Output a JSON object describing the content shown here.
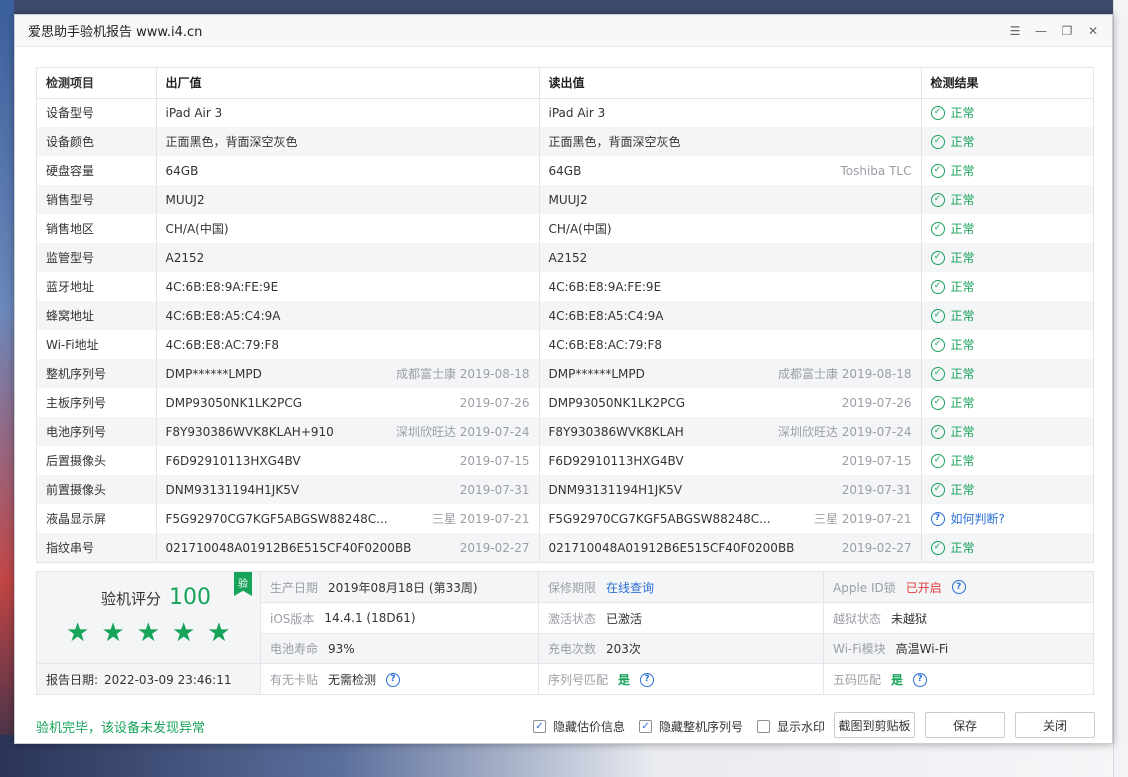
{
  "window": {
    "title": "爱思助手验机报告 www.i4.cn",
    "controls": [
      "menu-icon",
      "minimize-icon",
      "restore-icon",
      "close-icon"
    ]
  },
  "table": {
    "headers": [
      "检测项目",
      "出厂值",
      "读出值",
      "检测结果"
    ],
    "rows": [
      {
        "item": "设备型号",
        "factory": "iPad Air 3",
        "factory_note": "",
        "read": "iPad Air 3",
        "read_note": "",
        "result": "正常",
        "type": "ok"
      },
      {
        "item": "设备颜色",
        "factory": "正面黑色，背面深空灰色",
        "factory_note": "",
        "read": "正面黑色，背面深空灰色",
        "read_note": "",
        "result": "正常",
        "type": "ok"
      },
      {
        "item": "硬盘容量",
        "factory": "64GB",
        "factory_note": "",
        "read": "64GB",
        "read_note": "Toshiba TLC",
        "result": "正常",
        "type": "ok"
      },
      {
        "item": "销售型号",
        "factory": "MUUJ2",
        "factory_note": "",
        "read": "MUUJ2",
        "read_note": "",
        "result": "正常",
        "type": "ok"
      },
      {
        "item": "销售地区",
        "factory": "CH/A(中国)",
        "factory_note": "",
        "read": "CH/A(中国)",
        "read_note": "",
        "result": "正常",
        "type": "ok"
      },
      {
        "item": "监管型号",
        "factory": "A2152",
        "factory_note": "",
        "read": "A2152",
        "read_note": "",
        "result": "正常",
        "type": "ok"
      },
      {
        "item": "蓝牙地址",
        "factory": "4C:6B:E8:9A:FE:9E",
        "factory_note": "",
        "read": "4C:6B:E8:9A:FE:9E",
        "read_note": "",
        "result": "正常",
        "type": "ok"
      },
      {
        "item": "蜂窝地址",
        "factory": "4C:6B:E8:A5:C4:9A",
        "factory_note": "",
        "read": "4C:6B:E8:A5:C4:9A",
        "read_note": "",
        "result": "正常",
        "type": "ok"
      },
      {
        "item": "Wi-Fi地址",
        "factory": "4C:6B:E8:AC:79:F8",
        "factory_note": "",
        "read": "4C:6B:E8:AC:79:F8",
        "read_note": "",
        "result": "正常",
        "type": "ok"
      },
      {
        "item": "整机序列号",
        "factory": "DMP******LMPD",
        "factory_note": "成都富士康 2019-08-18",
        "read": "DMP******LMPD",
        "read_note": "成都富士康 2019-08-18",
        "result": "正常",
        "type": "ok"
      },
      {
        "item": "主板序列号",
        "factory": "DMP93050NK1LK2PCG",
        "factory_note": "2019-07-26",
        "read": "DMP93050NK1LK2PCG",
        "read_note": "2019-07-26",
        "result": "正常",
        "type": "ok"
      },
      {
        "item": "电池序列号",
        "factory": "F8Y930386WVK8KLAH+910",
        "factory_note": "深圳欣旺达 2019-07-24",
        "read": "F8Y930386WVK8KLAH",
        "read_note": "深圳欣旺达 2019-07-24",
        "result": "正常",
        "type": "ok"
      },
      {
        "item": "后置摄像头",
        "factory": "F6D92910113HXG4BV",
        "factory_note": "2019-07-15",
        "read": "F6D92910113HXG4BV",
        "read_note": "2019-07-15",
        "result": "正常",
        "type": "ok"
      },
      {
        "item": "前置摄像头",
        "factory": "DNM93131194H1JK5V",
        "factory_note": "2019-07-31",
        "read": "DNM93131194H1JK5V",
        "read_note": "2019-07-31",
        "result": "正常",
        "type": "ok"
      },
      {
        "item": "液晶显示屏",
        "factory": "F5G92970CG7KGF5ABGSW88248C...",
        "factory_note": "三星 2019-07-21",
        "read": "F5G92970CG7KGF5ABGSW88248C...",
        "read_note": "三星 2019-07-21",
        "result": "如何判断?",
        "type": "ask"
      },
      {
        "item": "指纹串号",
        "factory": "021710048A01912B6E515CF40F0200BB",
        "factory_note": "2019-02-27",
        "read": "021710048A01912B6E515CF40F0200BB",
        "read_note": "2019-02-27",
        "result": "正常",
        "type": "ok"
      }
    ]
  },
  "summary": {
    "score_label": "验机评分",
    "score": "100",
    "badge": "验",
    "stars": 5,
    "report_date_label": "报告日期:",
    "report_date": "2022-03-09 23:46:11",
    "info": [
      {
        "label": "生产日期",
        "value": "2019年08月18日 (第33周)",
        "style": "normal",
        "help": false
      },
      {
        "label": "保修期限",
        "value": "在线查询",
        "style": "link",
        "help": false
      },
      {
        "label": "Apple ID锁",
        "value": "已开启",
        "style": "red",
        "help": true
      },
      {
        "label": "iOS版本",
        "value": "14.4.1 (18D61)",
        "style": "normal",
        "help": false
      },
      {
        "label": "激活状态",
        "value": "已激活",
        "style": "normal",
        "help": false
      },
      {
        "label": "越狱状态",
        "value": "未越狱",
        "style": "normal",
        "help": false
      },
      {
        "label": "电池寿命",
        "value": "93%",
        "style": "normal",
        "help": false
      },
      {
        "label": "充电次数",
        "value": "203次",
        "style": "normal",
        "help": false
      },
      {
        "label": "Wi-Fi模块",
        "value": "高温Wi-Fi",
        "style": "normal",
        "help": false
      },
      {
        "label": "有无卡贴",
        "value": "无需检测",
        "style": "normal",
        "help": true
      },
      {
        "label": "序列号匹配",
        "value": "是",
        "style": "green",
        "help": true
      },
      {
        "label": "五码匹配",
        "value": "是",
        "style": "green",
        "help": true
      }
    ]
  },
  "footer": {
    "status": "验机完毕，该设备未发现异常",
    "options": [
      {
        "label": "隐藏估价信息",
        "checked": true
      },
      {
        "label": "隐藏整机序列号",
        "checked": true
      },
      {
        "label": "显示水印",
        "checked": false
      }
    ],
    "btn_copy": "截图到剪贴板",
    "btn_save": "保存",
    "btn_close": "关闭"
  },
  "colors": {
    "green": "#18a35a",
    "blue": "#2a6fd6",
    "red": "#e03a3a"
  }
}
